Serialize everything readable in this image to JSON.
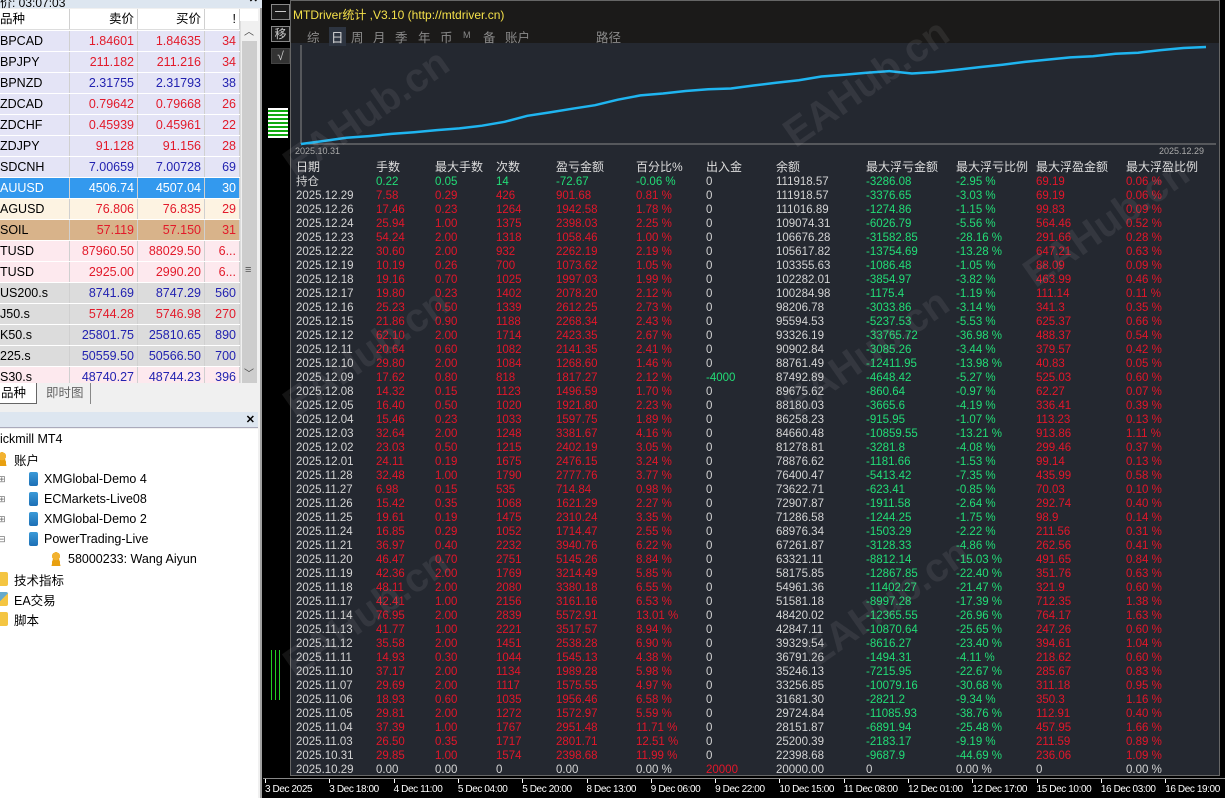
{
  "market_watch": {
    "title": "价: 03:07:03",
    "columns": [
      "品种",
      "卖价",
      "买价",
      "!"
    ],
    "rows": [
      {
        "symbol": "BPCAD",
        "bid": "1.84601",
        "ask": "1.84635",
        "spread": "34",
        "color": "red",
        "bg": "#e4e4f6"
      },
      {
        "symbol": "BPJPY",
        "bid": "211.182",
        "ask": "211.216",
        "spread": "34",
        "color": "red",
        "bg": "#e4e4f6"
      },
      {
        "symbol": "BPNZD",
        "bid": "2.31755",
        "ask": "2.31793",
        "spread": "38",
        "color": "blue",
        "bg": "#e4e4f6"
      },
      {
        "symbol": "ZDCAD",
        "bid": "0.79642",
        "ask": "0.79668",
        "spread": "26",
        "color": "red",
        "bg": "#e4e4f6"
      },
      {
        "symbol": "ZDCHF",
        "bid": "0.45939",
        "ask": "0.45961",
        "spread": "22",
        "color": "red",
        "bg": "#e4e4f6"
      },
      {
        "symbol": "ZDJPY",
        "bid": "91.128",
        "ask": "91.156",
        "spread": "28",
        "color": "red",
        "bg": "#e4e4f6"
      },
      {
        "symbol": "SDCNH",
        "bid": "7.00659",
        "ask": "7.00728",
        "spread": "69",
        "color": "blue",
        "bg": "#e4e4f6"
      },
      {
        "symbol": "AUUSD",
        "bid": "4506.74",
        "ask": "4507.04",
        "spread": "30",
        "color": "selected",
        "bg": "#3399ee"
      },
      {
        "symbol": "AGUSD",
        "bid": "76.806",
        "ask": "76.835",
        "spread": "29",
        "color": "red",
        "bg": "#fdf3e2"
      },
      {
        "symbol": "SOIL",
        "bid": "57.119",
        "ask": "57.150",
        "spread": "31",
        "color": "red",
        "bg": "#d8b38a"
      },
      {
        "symbol": "TUSD",
        "bid": "87960.50",
        "ask": "88029.50",
        "spread": "6...",
        "color": "red",
        "bg": "#fde9ee"
      },
      {
        "symbol": "TUSD",
        "bid": "2925.00",
        "ask": "2990.20",
        "spread": "6...",
        "color": "red",
        "bg": "#fde9ee"
      },
      {
        "symbol": "US200.s",
        "bid": "8741.69",
        "ask": "8747.29",
        "spread": "560",
        "color": "blue",
        "bg": "#dcdcdc"
      },
      {
        "symbol": "J50.s",
        "bid": "5744.28",
        "ask": "5746.98",
        "spread": "270",
        "color": "red",
        "bg": "#dcdcdc"
      },
      {
        "symbol": "K50.s",
        "bid": "25801.75",
        "ask": "25810.65",
        "spread": "890",
        "color": "blue",
        "bg": "#dcdcdc"
      },
      {
        "symbol": "225.s",
        "bid": "50559.50",
        "ask": "50566.50",
        "spread": "700",
        "color": "blue",
        "bg": "#dcdcdc"
      },
      {
        "symbol": "S30.s",
        "bid": "48740.27",
        "ask": "48744.23",
        "spread": "396",
        "color": "blue",
        "bg": "#fde9ee"
      }
    ],
    "tabs": [
      "品种",
      "即时图"
    ]
  },
  "navigator": {
    "items": [
      {
        "label": "ickmill MT4",
        "icon": "none"
      },
      {
        "label": "账户",
        "icon": "user-icon"
      },
      {
        "label": "XMGlobal-Demo 4",
        "icon": "server-icon"
      },
      {
        "label": "ECMarkets-Live08",
        "icon": "server-icon"
      },
      {
        "label": "XMGlobal-Demo 2",
        "icon": "server-icon"
      },
      {
        "label": "PowerTrading-Live",
        "icon": "server-icon"
      },
      {
        "label": "58000233: Wang Aiyun",
        "icon": "user-icon"
      },
      {
        "label": "技术指标",
        "icon": "folder-icon"
      },
      {
        "label": "EA交易",
        "icon": "ea-icon"
      },
      {
        "label": "脚本",
        "icon": "script-icon"
      }
    ]
  },
  "side_buttons": [
    "一",
    "移",
    "√"
  ],
  "panel": {
    "title": "MTDriver统计 ,V3.10 (http://mtdriver.cn)",
    "tabs": [
      "综",
      "日",
      "周",
      "月",
      "季",
      "年",
      "币",
      "M",
      "备",
      "账户",
      "路径"
    ],
    "active_tab": "日",
    "chart": {
      "start_label": "2025.10.31",
      "end_label": "2025.12.29",
      "line_color": "#1fb5f0"
    },
    "columns": [
      "日期",
      "手数",
      "最大手数",
      "次数",
      "盈亏金额",
      "百分比%",
      "出入金",
      "余额",
      "最大浮亏金额",
      "最大浮亏比例",
      "最大浮盈金额",
      "最大浮盈比例"
    ],
    "rows": [
      [
        "持仓",
        "0.22",
        "0.05",
        "14",
        "-72.67",
        "-0.06 %",
        "0",
        "111918.57",
        "-3286.08",
        "-2.95 %",
        "69.19",
        "0.06 %"
      ],
      [
        "2025.12.29",
        "7.58",
        "0.29",
        "426",
        "901.68",
        "0.81 %",
        "0",
        "111918.57",
        "-3376.65",
        "-3.03 %",
        "69.19",
        "0.06 %"
      ],
      [
        "2025.12.26",
        "17.46",
        "0.23",
        "1264",
        "1942.58",
        "1.78 %",
        "0",
        "111016.89",
        "-1274.86",
        "-1.15 %",
        "99.83",
        "0.09 %"
      ],
      [
        "2025.12.24",
        "25.94",
        "1.00",
        "1375",
        "2398.03",
        "2.25 %",
        "0",
        "109074.31",
        "-6026.79",
        "-5.56 %",
        "564.46",
        "0.52 %"
      ],
      [
        "2025.12.23",
        "54.24",
        "2.00",
        "1318",
        "1058.46",
        "1.00 %",
        "0",
        "106676.28",
        "-31582.85",
        "-28.16 %",
        "291.66",
        "0.28 %"
      ],
      [
        "2025.12.22",
        "30.60",
        "2.00",
        "932",
        "2262.19",
        "2.19 %",
        "0",
        "105617.82",
        "-13754.69",
        "-13.28 %",
        "647.21",
        "0.63 %"
      ],
      [
        "2025.12.19",
        "10.19",
        "0.26",
        "700",
        "1073.62",
        "1.05 %",
        "0",
        "103355.63",
        "-1086.48",
        "-1.05 %",
        "88.09",
        "0.09 %"
      ],
      [
        "2025.12.18",
        "19.16",
        "0.70",
        "1025",
        "1997.03",
        "1.99 %",
        "0",
        "102282.01",
        "-3854.97",
        "-3.82 %",
        "463.99",
        "0.46 %"
      ],
      [
        "2025.12.17",
        "19.80",
        "0.23",
        "1402",
        "2078.20",
        "2.12 %",
        "0",
        "100284.98",
        "-1175.4",
        "-1.19 %",
        "111.14",
        "0.11 %"
      ],
      [
        "2025.12.16",
        "25.23",
        "0.50",
        "1339",
        "2612.25",
        "2.73 %",
        "0",
        "98206.78",
        "-3033.86",
        "-3.14 %",
        "341.3",
        "0.35 %"
      ],
      [
        "2025.12.15",
        "21.86",
        "0.90",
        "1188",
        "2268.34",
        "2.43 %",
        "0",
        "95594.53",
        "-5237.53",
        "-5.53 %",
        "625.37",
        "0.66 %"
      ],
      [
        "2025.12.12",
        "62.10",
        "2.00",
        "1714",
        "2423.35",
        "2.67 %",
        "0",
        "93326.19",
        "-33765.72",
        "-36.98 %",
        "488.37",
        "0.54 %"
      ],
      [
        "2025.12.11",
        "20.64",
        "0.60",
        "1082",
        "2141.35",
        "2.41 %",
        "0",
        "90902.84",
        "-3085.26",
        "-3.44 %",
        "379.57",
        "0.42 %"
      ],
      [
        "2025.12.10",
        "29.80",
        "2.00",
        "1084",
        "1268.60",
        "1.46 %",
        "0",
        "88761.49",
        "-12411.95",
        "-13.98 %",
        "40.83",
        "0.05 %"
      ],
      [
        "2025.12.09",
        "17.62",
        "0.80",
        "818",
        "1817.27",
        "2.12 %",
        "-4000",
        "87492.89",
        "-4648.42",
        "-5.27 %",
        "525.03",
        "0.60 %"
      ],
      [
        "2025.12.08",
        "14.32",
        "0.15",
        "1123",
        "1496.59",
        "1.70 %",
        "0",
        "89675.62",
        "-860.64",
        "-0.97 %",
        "62.27",
        "0.07 %"
      ],
      [
        "2025.12.05",
        "16.40",
        "0.50",
        "1020",
        "1921.80",
        "2.23 %",
        "0",
        "88180.03",
        "-3665.6",
        "-4.19 %",
        "336.41",
        "0.39 %"
      ],
      [
        "2025.12.04",
        "15.46",
        "0.23",
        "1033",
        "1597.75",
        "1.89 %",
        "0",
        "86258.23",
        "-915.95",
        "-1.07 %",
        "113.23",
        "0.13 %"
      ],
      [
        "2025.12.03",
        "32.64",
        "2.00",
        "1248",
        "3381.67",
        "4.16 %",
        "0",
        "84660.48",
        "-10859.55",
        "-13.21 %",
        "913.86",
        "1.11 %"
      ],
      [
        "2025.12.02",
        "23.03",
        "0.50",
        "1215",
        "2402.19",
        "3.05 %",
        "0",
        "81278.81",
        "-3281.8",
        "-4.08 %",
        "299.46",
        "0.37 %"
      ],
      [
        "2025.12.01",
        "24.11",
        "0.19",
        "1675",
        "2476.15",
        "3.24 %",
        "0",
        "78876.62",
        "-1181.66",
        "-1.53 %",
        "99.14",
        "0.13 %"
      ],
      [
        "2025.11.28",
        "32.48",
        "1.00",
        "1790",
        "2777.76",
        "3.77 %",
        "0",
        "76400.47",
        "-5413.42",
        "-7.35 %",
        "435.99",
        "0.58 %"
      ],
      [
        "2025.11.27",
        "6.98",
        "0.15",
        "535",
        "714.84",
        "0.98 %",
        "0",
        "73622.71",
        "-623.41",
        "-0.85 %",
        "70.03",
        "0.10 %"
      ],
      [
        "2025.11.26",
        "15.42",
        "0.35",
        "1068",
        "1621.29",
        "2.27 %",
        "0",
        "72907.87",
        "-1911.58",
        "-2.64 %",
        "292.74",
        "0.40 %"
      ],
      [
        "2025.11.25",
        "19.61",
        "0.19",
        "1475",
        "2310.24",
        "3.35 %",
        "0",
        "71286.58",
        "-1244.25",
        "-1.75 %",
        "98.9",
        "0.14 %"
      ],
      [
        "2025.11.24",
        "16.85",
        "0.29",
        "1052",
        "1714.47",
        "2.55 %",
        "0",
        "68976.34",
        "-1503.29",
        "-2.22 %",
        "211.56",
        "0.31 %"
      ],
      [
        "2025.11.21",
        "36.97",
        "0.40",
        "2232",
        "3940.76",
        "6.22 %",
        "0",
        "67261.87",
        "-3128.33",
        "-4.86 %",
        "262.56",
        "0.41 %"
      ],
      [
        "2025.11.20",
        "46.47",
        "0.70",
        "2751",
        "5145.26",
        "8.84 %",
        "0",
        "63321.11",
        "-8812.14",
        "-15.03 %",
        "491.65",
        "0.84 %"
      ],
      [
        "2025.11.19",
        "42.36",
        "2.00",
        "1769",
        "3214.49",
        "5.85 %",
        "0",
        "58175.85",
        "-12867.85",
        "-22.40 %",
        "351.76",
        "0.63 %"
      ],
      [
        "2025.11.18",
        "48.11",
        "2.00",
        "2080",
        "3380.18",
        "6.55 %",
        "0",
        "54961.36",
        "-11402.27",
        "-21.47 %",
        "321.9",
        "0.60 %"
      ],
      [
        "2025.11.17",
        "42.41",
        "1.00",
        "2156",
        "3161.16",
        "6.53 %",
        "0",
        "51581.18",
        "-8997.28",
        "-17.39 %",
        "712.35",
        "1.38 %"
      ],
      [
        "2025.11.14",
        "76.95",
        "2.00",
        "2839",
        "5572.91",
        "13.01 %",
        "0",
        "48420.02",
        "-12365.55",
        "-26.96 %",
        "764.17",
        "1.63 %"
      ],
      [
        "2025.11.13",
        "41.77",
        "1.00",
        "2221",
        "3517.57",
        "8.94 %",
        "0",
        "42847.11",
        "-10870.64",
        "-25.65 %",
        "247.26",
        "0.60 %"
      ],
      [
        "2025.11.12",
        "35.58",
        "2.00",
        "1451",
        "2538.28",
        "6.90 %",
        "0",
        "39329.54",
        "-8616.27",
        "-23.40 %",
        "394.61",
        "1.04 %"
      ],
      [
        "2025.11.11",
        "14.93",
        "0.30",
        "1044",
        "1545.13",
        "4.38 %",
        "0",
        "36791.26",
        "-1494.31",
        "-4.11 %",
        "218.62",
        "0.60 %"
      ],
      [
        "2025.11.10",
        "37.17",
        "2.00",
        "1134",
        "1989.28",
        "5.98 %",
        "0",
        "35246.13",
        "-7215.95",
        "-22.67 %",
        "285.67",
        "0.83 %"
      ],
      [
        "2025.11.07",
        "29.69",
        "2.00",
        "1117",
        "1575.55",
        "4.97 %",
        "0",
        "33256.85",
        "-10079.16",
        "-30.68 %",
        "311.18",
        "0.95 %"
      ],
      [
        "2025.11.06",
        "18.93",
        "0.60",
        "1035",
        "1956.46",
        "6.58 %",
        "0",
        "31681.30",
        "-2821.2",
        "-9.34 %",
        "350.3",
        "1.16 %"
      ],
      [
        "2025.11.05",
        "29.81",
        "2.00",
        "1272",
        "1572.97",
        "5.59 %",
        "0",
        "29724.84",
        "-11085.93",
        "-38.76 %",
        "112.91",
        "0.40 %"
      ],
      [
        "2025.11.04",
        "37.39",
        "1.00",
        "1767",
        "2951.48",
        "11.71 %",
        "0",
        "28151.87",
        "-6891.94",
        "-25.48 %",
        "457.95",
        "1.66 %"
      ],
      [
        "2025.11.03",
        "26.50",
        "0.35",
        "1717",
        "2801.71",
        "12.51 %",
        "0",
        "25200.39",
        "-2183.17",
        "-9.19 %",
        "211.59",
        "0.89 %"
      ],
      [
        "2025.10.31",
        "29.85",
        "1.00",
        "1574",
        "2398.68",
        "11.99 %",
        "0",
        "22398.68",
        "-9687.9",
        "-44.69 %",
        "236.06",
        "1.09 %"
      ],
      [
        "2025.10.29",
        "0.00",
        "0.00",
        "0",
        "0.00",
        "0.00 %",
        "20000",
        "20000.00",
        "0",
        "0.00 %",
        "0",
        "0.00 %"
      ]
    ]
  },
  "time_axis": [
    "3 Dec 2025",
    "3 Dec 18:00",
    "4 Dec 11:00",
    "5 Dec 04:00",
    "5 Dec 20:00",
    "8 Dec 13:00",
    "9 Dec 06:00",
    "9 Dec 22:00",
    "10 Dec 15:00",
    "11 Dec 08:00",
    "12 Dec 01:00",
    "12 Dec 17:00",
    "15 Dec 10:00",
    "16 Dec 03:00",
    "16 Dec 19:00"
  ],
  "watermark": "EAHub.cn"
}
